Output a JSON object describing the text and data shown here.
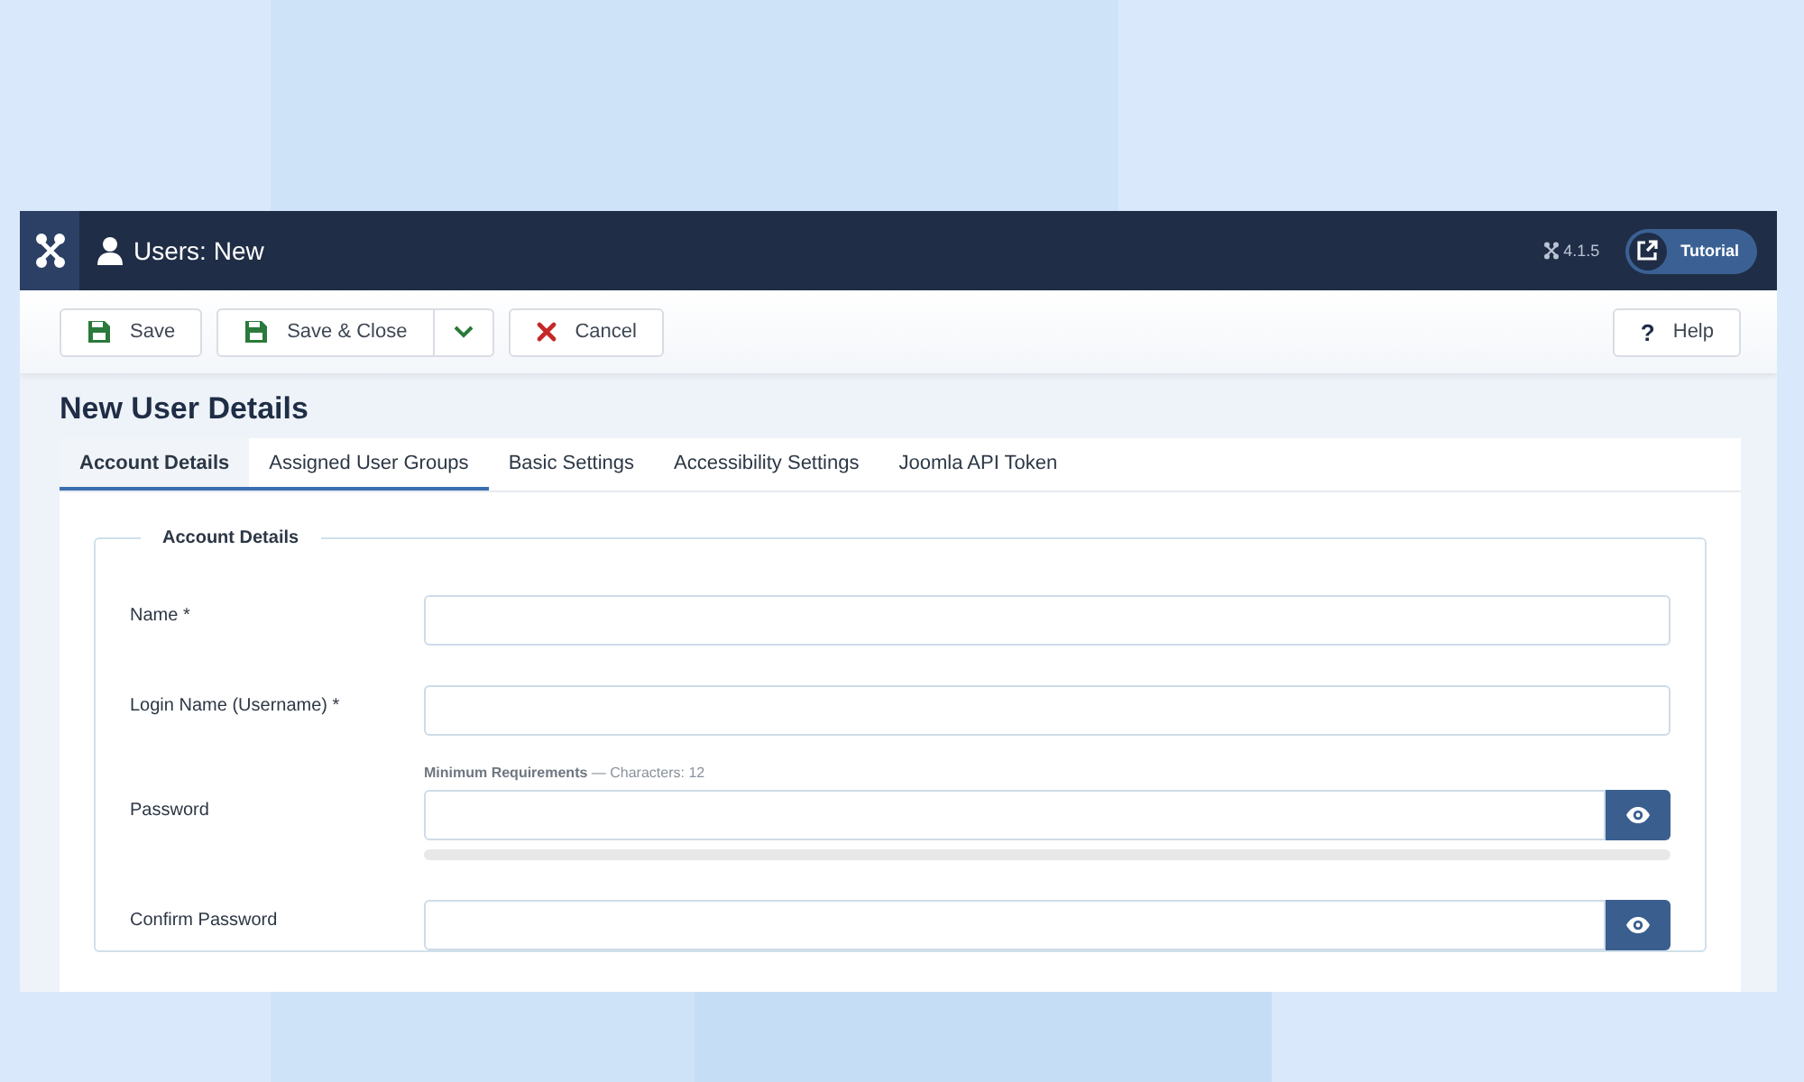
{
  "header": {
    "title": "Users: New",
    "version": "4.1.5",
    "tutorial": "Tutorial"
  },
  "toolbar": {
    "buttons": [
      {
        "label": "Save",
        "kind": "save"
      },
      {
        "label": "Save & Close",
        "kind": "save-split"
      },
      {
        "label": "Cancel",
        "kind": "cancel"
      }
    ],
    "help_icon": "?",
    "help": "Help"
  },
  "page_title": "New User Details",
  "tabs": [
    {
      "label": "Account Details",
      "selected": true
    },
    {
      "label": "Assigned User Groups",
      "selected": false
    },
    {
      "label": "Basic Settings",
      "selected": false
    },
    {
      "label": "Accessibility Settings",
      "selected": false
    },
    {
      "label": "Joomla API Token",
      "selected": false
    }
  ],
  "fieldset": {
    "legend": "Account Details",
    "fields": [
      {
        "label": "Name *",
        "kind": "text"
      },
      {
        "label": "Login Name (Username) *",
        "kind": "text"
      },
      {
        "label": "Password",
        "kind": "password",
        "hint_bold": "Minimum Requirements",
        "hint": "— Characters: 12",
        "level": 0
      },
      {
        "label": "Confirm Password",
        "kind": "password"
      }
    ]
  }
}
